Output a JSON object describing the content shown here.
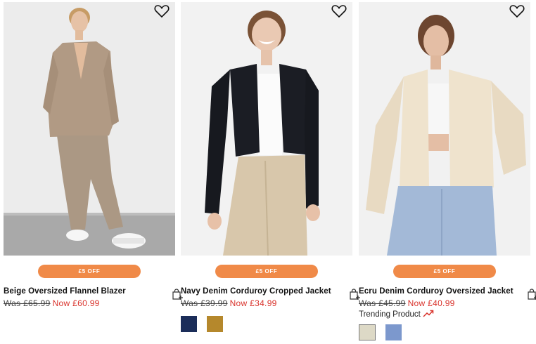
{
  "colors": {
    "badge": "#f08a48",
    "sale_price": "#d9322b"
  },
  "products": [
    {
      "name": "Beige Oversized Flannel Blazer",
      "badge": "£5 OFF",
      "was": "Was £65.99",
      "now": "Now £60.99",
      "wishlist_icon": "heart-outline-icon",
      "bag_icon": "add-to-bag-icon",
      "swatches": []
    },
    {
      "name": "Navy Denim Corduroy Cropped Jacket",
      "badge": "£5 OFF",
      "was": "Was £39.99",
      "now": "Now £34.99",
      "wishlist_icon": "heart-outline-icon",
      "bag_icon": "add-to-bag-icon",
      "swatches": [
        "#1b2d59",
        "#b5882c"
      ]
    },
    {
      "name": "Ecru Denim Corduroy Oversized Jacket",
      "badge": "£5 OFF",
      "was": "Was £45.99",
      "now": "Now £40.99",
      "trending": "Trending Product",
      "wishlist_icon": "heart-outline-icon",
      "bag_icon": "add-to-bag-icon",
      "trend_icon": "trending-up-icon",
      "swatches": [
        "#ddd9c6",
        "#7c98cd"
      ]
    }
  ]
}
